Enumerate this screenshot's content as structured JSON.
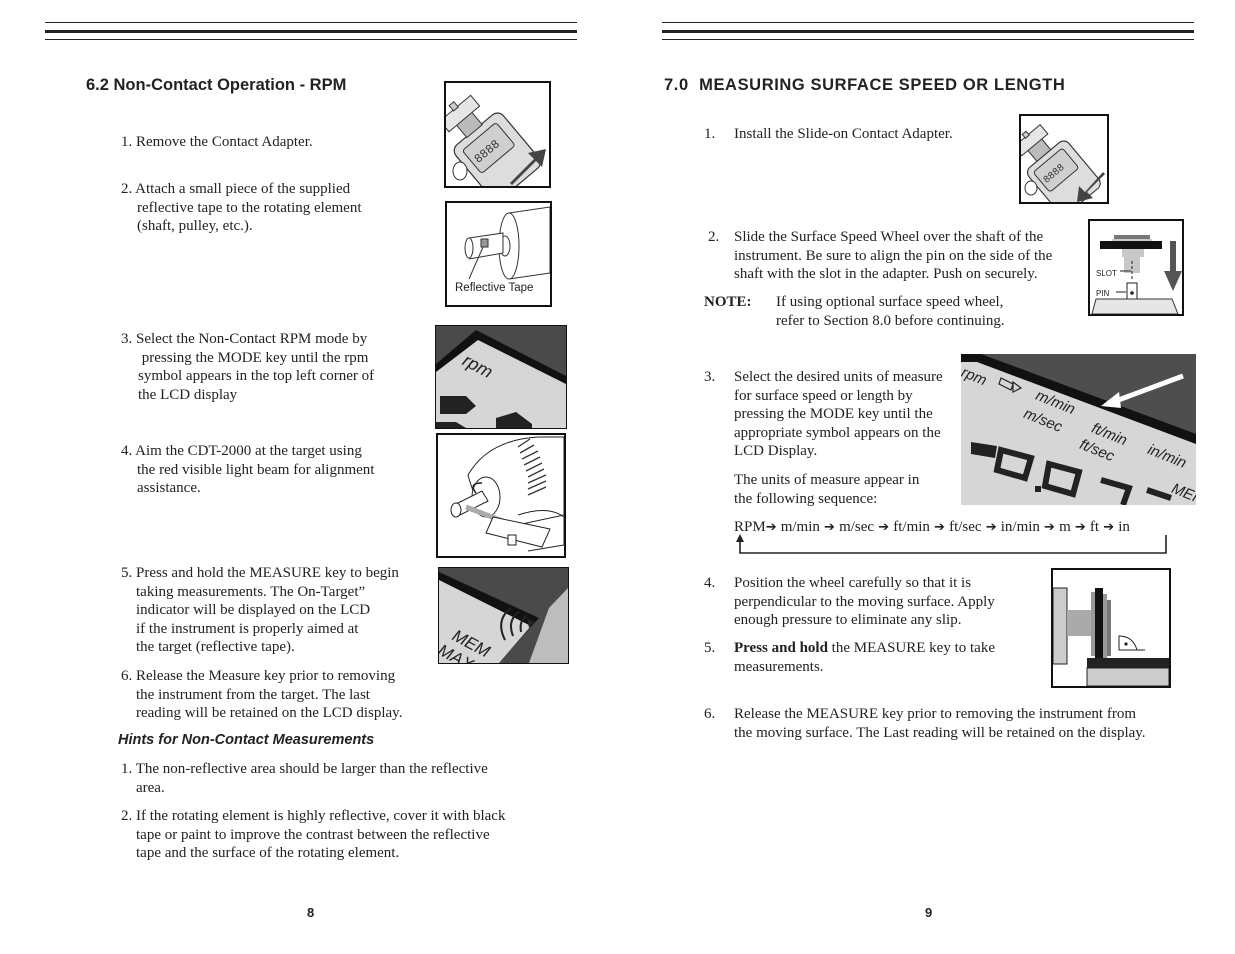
{
  "left_page": {
    "section_title": "6.2  Non-Contact Operation - RPM",
    "steps": [
      {
        "lines": [
          "1.  Remove the Contact Adapter."
        ]
      },
      {
        "lines": [
          "2.  Attach a small piece of the supplied",
          "reflective tape to the rotating element",
          "(shaft, pulley, etc.)."
        ]
      },
      {
        "lines": [
          "3. Select the Non-Contact RPM mode by",
          " pressing the MODE key until the rpm",
          "symbol appears in the top left corner of",
          "the LCD display"
        ]
      },
      {
        "lines": [
          "4.  Aim the CDT-2000 at the target using",
          "the red visible light beam for alignment",
          "assistance."
        ]
      },
      {
        "lines": [
          "5.  Press and hold the MEASURE key to begin",
          "taking measurements. The On-Target”",
          "indicator will be displayed on the LCD",
          "if the instrument is properly aimed at",
          "the target (reflective tape)."
        ]
      },
      {
        "lines": [
          "6. Release the Measure key prior to removing",
          "the instrument from the target. The last",
          "reading will be retained on the LCD display."
        ]
      }
    ],
    "hints_title": "Hints for Non-Contact Measurements",
    "hints": [
      {
        "lines": [
          "1. The non-reflective area should be larger than the reflective",
          "area."
        ]
      },
      {
        "lines": [
          "2. If the rotating element is highly reflective, cover it with black",
          "tape or paint to improve the contrast between the reflective",
          "tape and the surface of the rotating element."
        ]
      }
    ],
    "figures": {
      "tape_label": "Reflective Tape",
      "lcd_rpm_label": "rpm",
      "lcd_mem_label": "MEM",
      "lcd_max_label": "MAX"
    },
    "page_number": "8"
  },
  "right_page": {
    "section_title": "7.0  MEASURING SURFACE SPEED OR LENGTH",
    "step1": {
      "num": "1.",
      "text": "Install the Slide-on Contact Adapter."
    },
    "step2": {
      "num": "2.",
      "lines": [
        "Slide the Surface Speed Wheel over the shaft of the",
        "instrument. Be sure to align the pin on the side of the",
        "shaft with the slot in the adapter. Push on securely."
      ]
    },
    "note": {
      "label": "NOTE:",
      "lines": [
        "If using optional surface speed wheel,",
        "refer to Section 8.0 before continuing."
      ]
    },
    "step3": {
      "num": "3.",
      "lines": [
        "Select the desired units of measure",
        "for surface speed or length by",
        "pressing the MODE key until the",
        "appropriate symbol appears on the",
        "LCD Display."
      ]
    },
    "sequence_intro": [
      "The units of measure appear in",
      "the following sequence:"
    ],
    "sequence": [
      "RPM",
      "m/min",
      "m/sec",
      "ft/min",
      "ft/sec",
      "in/min",
      "m",
      "ft",
      "in"
    ],
    "sequence_arrow": "➔",
    "step4": {
      "num": "4.",
      "lines": [
        "Position the wheel carefully so that it is",
        "perpendicular to the moving surface. Apply",
        "enough pressure to eliminate any slip."
      ]
    },
    "step5": {
      "num": "5.",
      "bold": "Press and hold",
      "rest": " the MEASURE key to take",
      "line2": "measurements."
    },
    "step6": {
      "num": "6.",
      "lines": [
        "Release the MEASURE key prior to removing the instrument from",
        "the moving surface. The Last reading will be retained on the display."
      ]
    },
    "figures": {
      "slot_label": "SLOT",
      "pin_label": "PIN",
      "lcd_units": [
        "rpm",
        "m/min",
        "m/sec",
        "ft/min",
        "ft/sec",
        "in/min",
        "MEM"
      ]
    },
    "page_number": "9"
  }
}
